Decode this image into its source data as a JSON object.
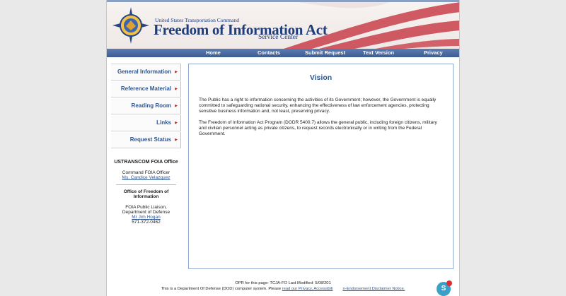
{
  "banner": {
    "agency": "United States Transportation Command",
    "title": "Freedom of Information Act",
    "subtitle": "Service Center"
  },
  "nav": [
    {
      "label": "Home"
    },
    {
      "label": "Contacts"
    },
    {
      "label": "Submit Request"
    },
    {
      "label": "Text Version"
    },
    {
      "label": "Privacy"
    }
  ],
  "sidebar": {
    "items": [
      {
        "label": "General Information"
      },
      {
        "label": "Reference Material"
      },
      {
        "label": "Reading Room"
      },
      {
        "label": "Links"
      },
      {
        "label": "Request Status"
      }
    ],
    "office_title": "USTRANSCOM FOIA Office",
    "officer_role": "Command FOIA Officer",
    "officer_name": "Ms. Candice Velazquez",
    "ofoi_title": "Office of Freedom of Information",
    "liaison_role": "FOIA Public Liaison,",
    "liaison_dept": "Department of Defense",
    "liaison_name": "Mr Jim Hogan",
    "liaison_phone": "571-372-0462"
  },
  "main": {
    "heading": "Vision",
    "para1": "The Public has a right to information concerning the activities of its Government; however, the Government is equally committed to safeguarding national security, enhancing the effectiveness of law enforcement agencies, protecting sensitive business information and, not least, preserving privacy.",
    "para2": "The Freedom of Information Act Program (DODR 5400.7) allows the general public, including foreign citizens, military and civilian personnel acting as private citizens, to request records electronically or in writing from the Federal Government."
  },
  "footer": {
    "line1": "OPR for this page: TCJA-FO    Last Modified: 5/08/201",
    "line2_prefix": "This is a Department Of Defense (DOD) computer system. Please ",
    "line2_link1": "read our Privacy, Accessibili",
    "line2_link2": "n-Endorsement Disclaimer Notice."
  },
  "colors": {
    "brand_blue": "#1f3d7a",
    "link_blue": "#2e5694",
    "nav_bar": "#3d5c94"
  }
}
